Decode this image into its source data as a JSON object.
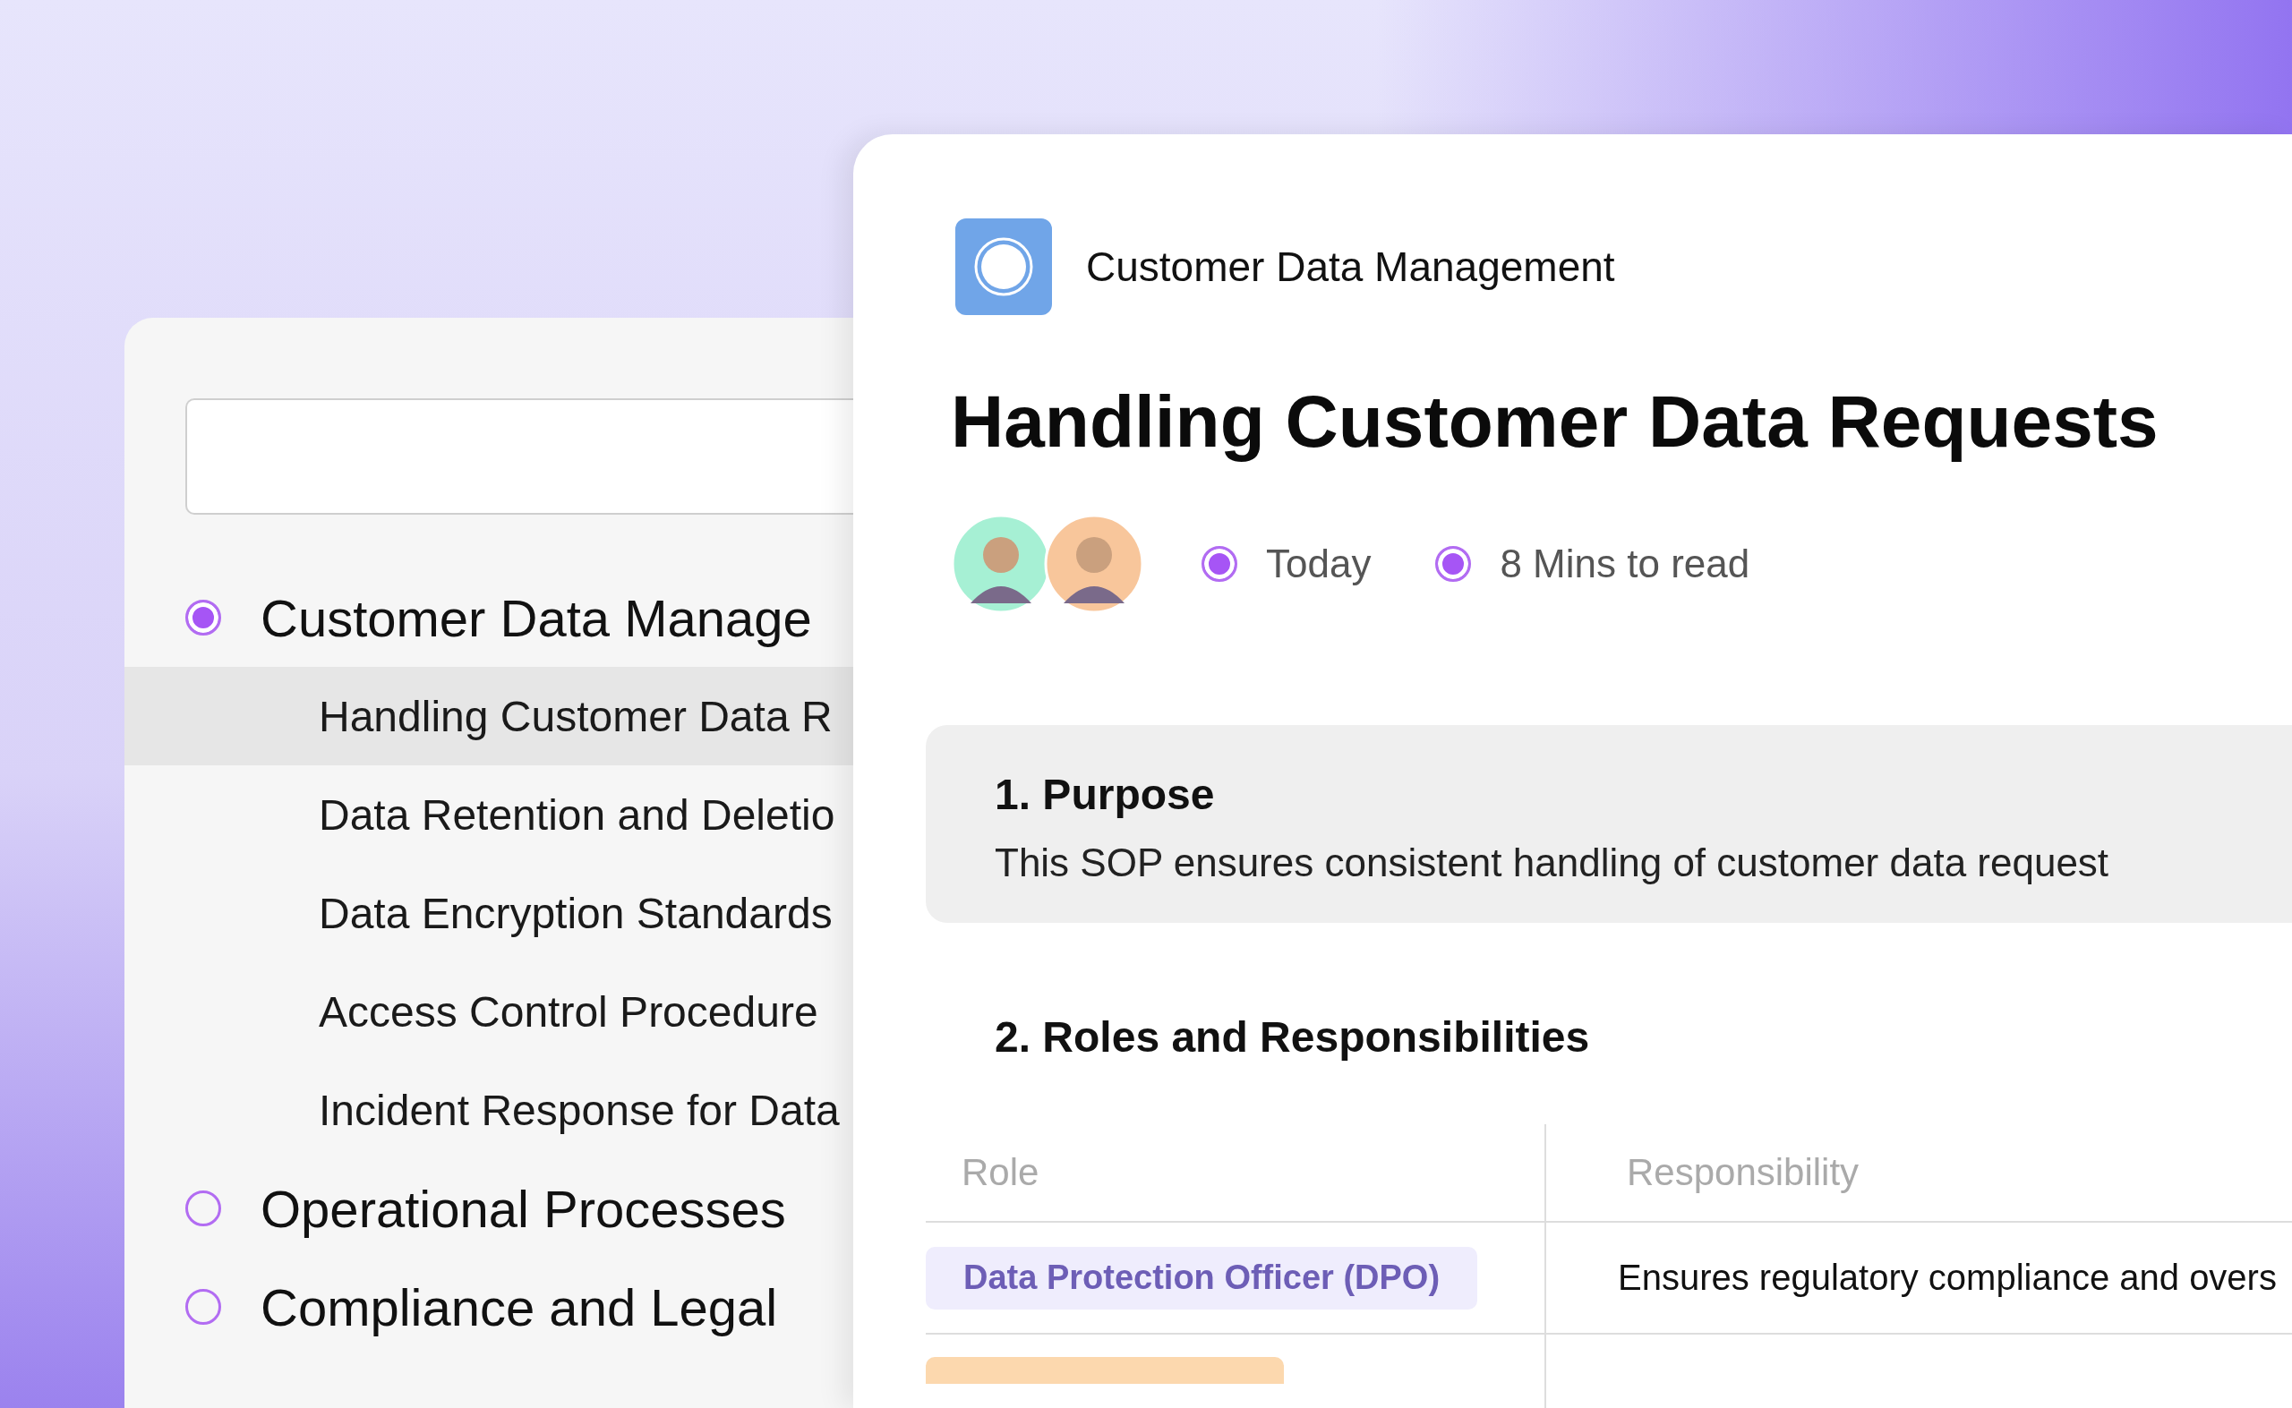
{
  "sidebar": {
    "items": [
      {
        "label": "Customer Data Manage",
        "selected": true,
        "children": [
          {
            "label": "Handling Customer Data R",
            "selected": true
          },
          {
            "label": "Data Retention and Deletio",
            "selected": false
          },
          {
            "label": "Data Encryption Standards",
            "selected": false
          },
          {
            "label": "Access Control Procedure",
            "selected": false
          },
          {
            "label": "Incident Response for Data",
            "selected": false
          }
        ]
      },
      {
        "label": "Operational Processes",
        "selected": false
      },
      {
        "label": "Compliance and Legal",
        "selected": false
      }
    ]
  },
  "document": {
    "breadcrumb": "Customer Data Management",
    "title": "Handling Customer Data Requests",
    "authors": [
      {
        "color": "#a6f0d4"
      },
      {
        "color": "#f8c69b"
      }
    ],
    "meta": [
      {
        "text": "Today"
      },
      {
        "text": "8 Mins to read"
      }
    ],
    "sections": [
      {
        "kind": "callout",
        "heading": "1. Purpose",
        "body": "This SOP ensures consistent handling of customer data request"
      },
      {
        "kind": "table",
        "heading": "2. Roles and Responsibilities",
        "table": {
          "columns": [
            "Role",
            "Responsibility"
          ],
          "rows": [
            {
              "role": "Data Protection Officer (DPO)",
              "color": "#efedfd",
              "responsibility": "Ensures regulatory compliance and overs"
            },
            {
              "color": "#fcd8ae"
            }
          ]
        }
      }
    ]
  }
}
